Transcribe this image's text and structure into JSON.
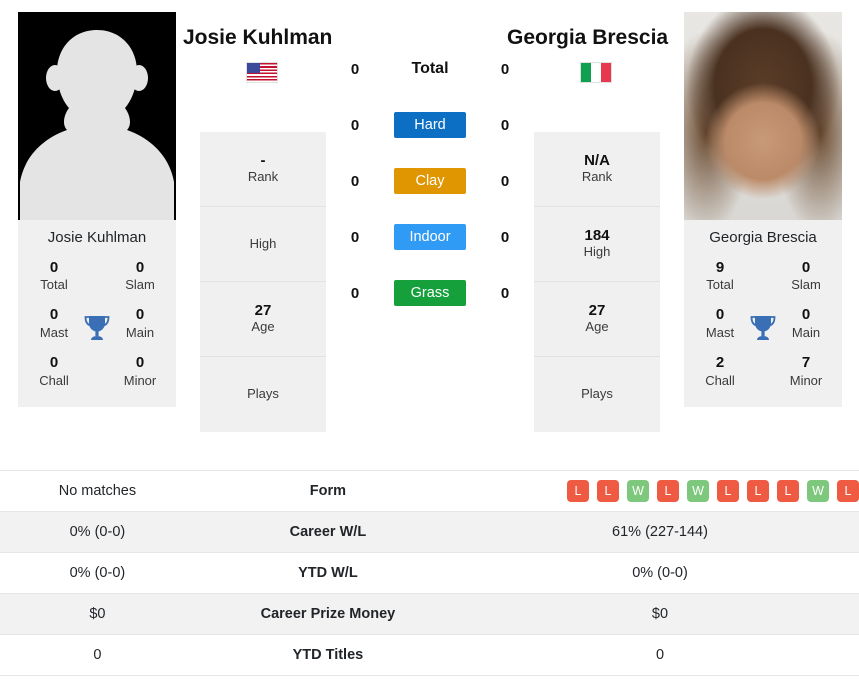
{
  "players": {
    "left": {
      "name": "Josie Kuhlman",
      "flag": "us-flag-icon",
      "card_name": "Josie Kuhlman",
      "avatar": "default-avatar-silhouette",
      "rank": "-",
      "rank_label": "Rank",
      "high": "",
      "high_label": "High",
      "age": "27",
      "age_label": "Age",
      "plays": "",
      "plays_label": "Plays",
      "titles": {
        "total": "0",
        "total_label": "Total",
        "slam": "0",
        "slam_label": "Slam",
        "mast": "0",
        "mast_label": "Mast",
        "main": "0",
        "main_label": "Main",
        "chall": "0",
        "chall_label": "Chall",
        "minor": "0",
        "minor_label": "Minor"
      }
    },
    "right": {
      "name": "Georgia Brescia",
      "flag": "it-flag-icon",
      "card_name": "Georgia Brescia",
      "avatar": "player-photo",
      "rank": "N/A",
      "rank_label": "Rank",
      "high": "184",
      "high_label": "High",
      "age": "27",
      "age_label": "Age",
      "plays": "",
      "plays_label": "Plays",
      "titles": {
        "total": "9",
        "total_label": "Total",
        "slam": "0",
        "slam_label": "Slam",
        "mast": "0",
        "mast_label": "Mast",
        "main": "0",
        "main_label": "Main",
        "chall": "2",
        "chall_label": "Chall",
        "minor": "7",
        "minor_label": "Minor"
      }
    }
  },
  "surface_stats": [
    {
      "label": "Total",
      "left": "0",
      "right": "0",
      "type": "plain",
      "color": ""
    },
    {
      "label": "Hard",
      "left": "0",
      "right": "0",
      "type": "badge",
      "color": "#0d6fc4"
    },
    {
      "label": "Clay",
      "left": "0",
      "right": "0",
      "type": "badge",
      "color": "#e09600"
    },
    {
      "label": "Indoor",
      "left": "0",
      "right": "0",
      "type": "badge",
      "color": "#2f9bf5"
    },
    {
      "label": "Grass",
      "left": "0",
      "right": "0",
      "type": "badge",
      "color": "#15a03c"
    }
  ],
  "comparison_rows": [
    {
      "label": "Form",
      "left": "No matches",
      "right_type": "form",
      "right_form": [
        "L",
        "L",
        "W",
        "L",
        "W",
        "L",
        "L",
        "L",
        "W",
        "L"
      ],
      "shaded": false
    },
    {
      "label": "Career W/L",
      "left": "0% (0-0)",
      "right": "61% (227-144)",
      "right_type": "text",
      "shaded": true
    },
    {
      "label": "YTD W/L",
      "left": "0% (0-0)",
      "right": "0% (0-0)",
      "right_type": "text",
      "shaded": false
    },
    {
      "label": "Career Prize Money",
      "left": "$0",
      "right": "$0",
      "right_type": "text",
      "shaded": true
    },
    {
      "label": "YTD Titles",
      "left": "0",
      "right": "0",
      "right_type": "text",
      "shaded": false
    }
  ],
  "colors": {
    "win": "#7ec87e",
    "loss": "#ef5a42",
    "trophy": "#3a6eb5",
    "card_bg": "#f0f0f0",
    "row_shaded": "#f2f2f2"
  }
}
